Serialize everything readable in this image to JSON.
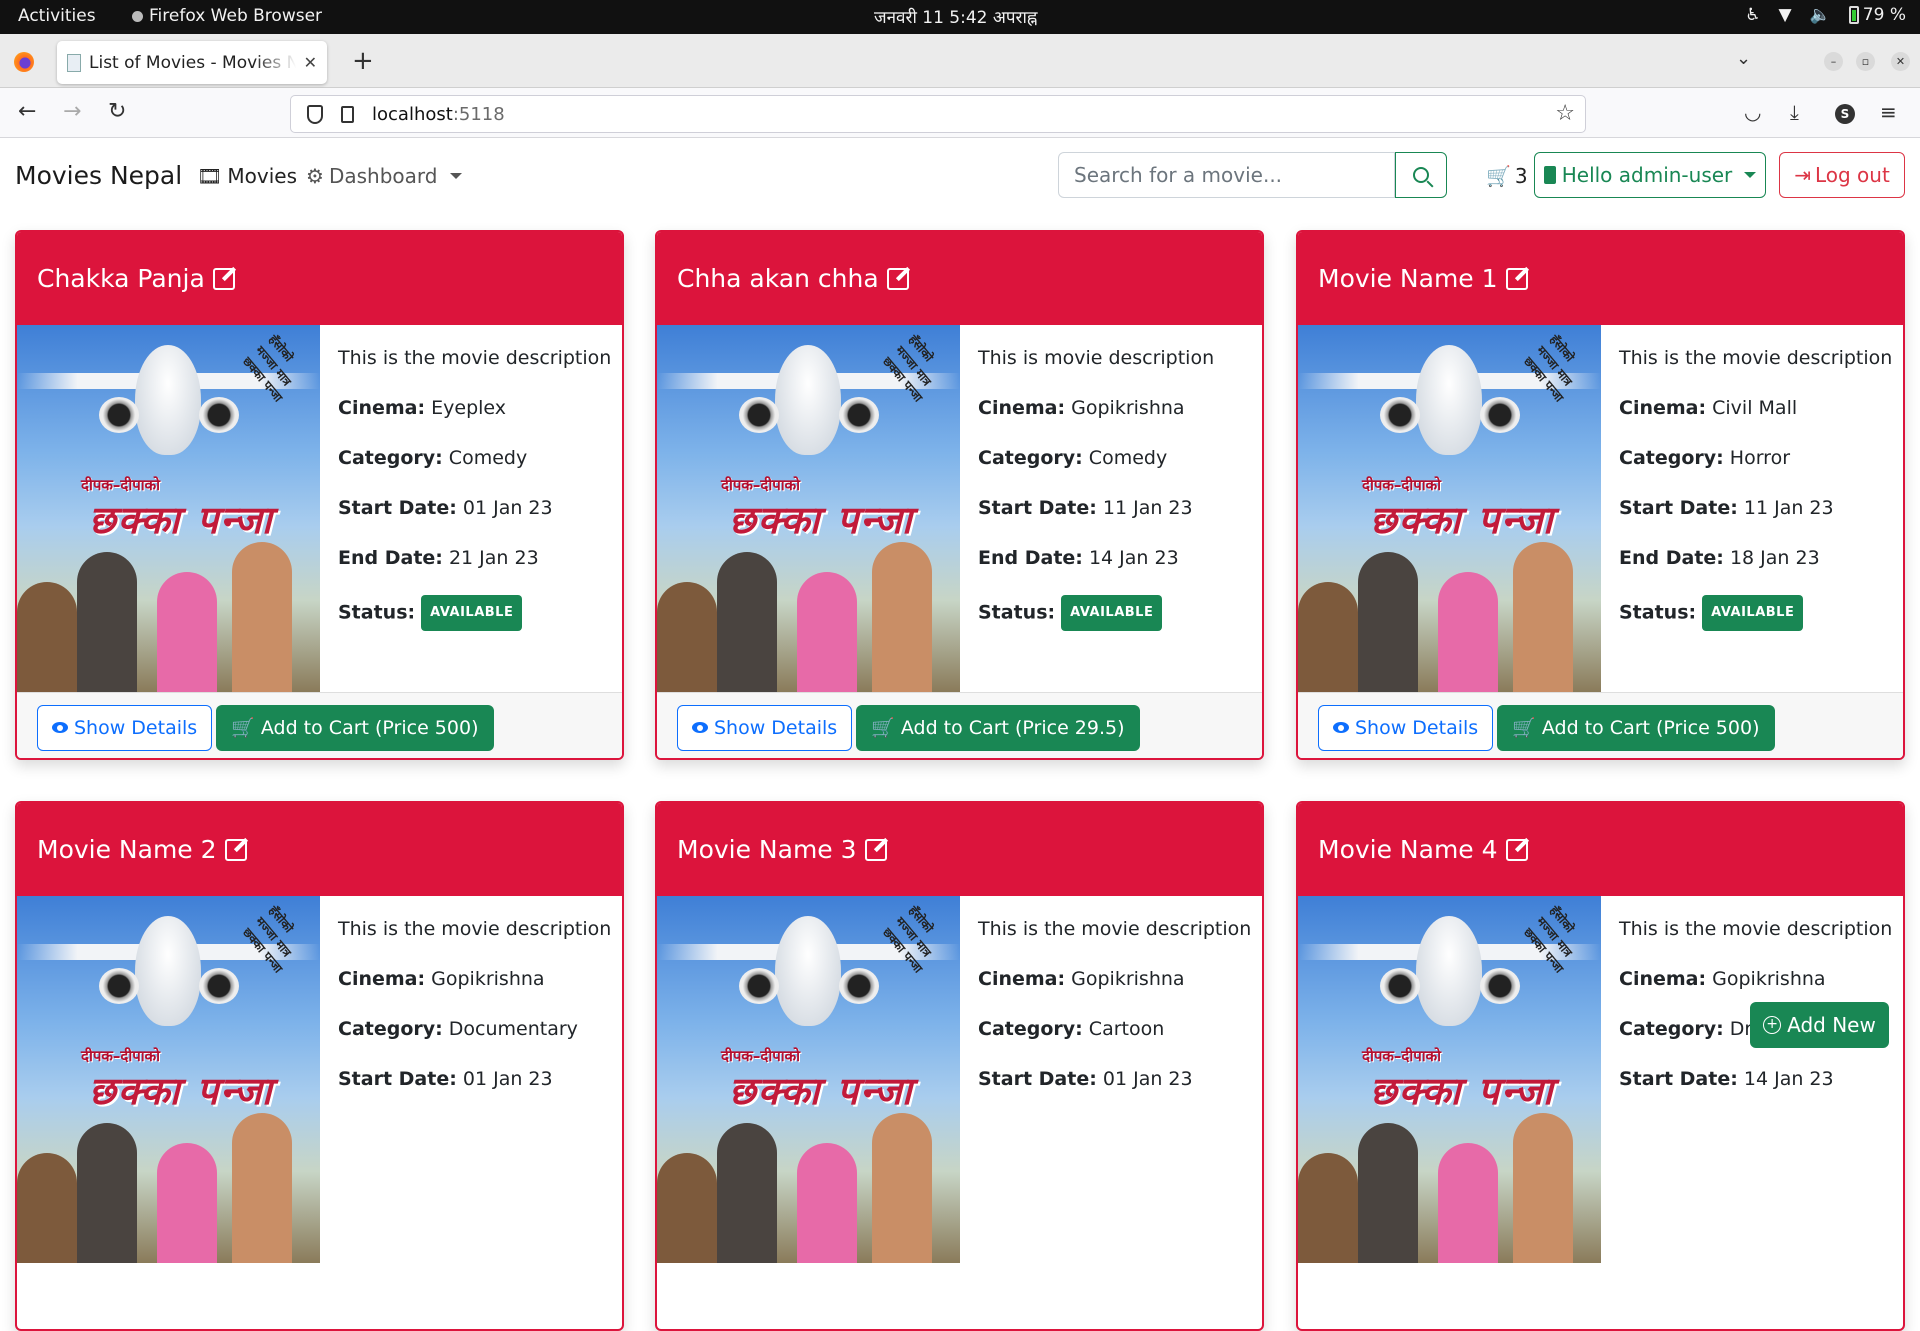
{
  "system": {
    "activities": "Activities",
    "app_name": "Firefox Web Browser",
    "clock": "जनवरी 11   5:42 अपराह्न",
    "battery": "79 %"
  },
  "browser": {
    "tab_title": "List of Movies - Movies Nepal",
    "url_host": "localhost",
    "url_port": ":5118",
    "profile_initial": "S"
  },
  "nav": {
    "brand": "Movies Nepal",
    "movies": "Movies",
    "dashboard": "Dashboard",
    "search_placeholder": "Search for a movie...",
    "cart_count": "3",
    "user_label": "Hello admin-user",
    "logout": "Log out"
  },
  "labels": {
    "cinema": "Cinema:",
    "category": "Category:",
    "start": "Start Date:",
    "end": "End Date:",
    "status": "Status:",
    "show_details": "Show Details",
    "add_new": "Add New"
  },
  "poster": {
    "line1": "दीपक–दीपाको",
    "line2": "छक्का पन्जा",
    "tagline": "हँसाेको मज्जा मात्र छक्का पन्जा"
  },
  "movies": [
    {
      "title": "Chakka Panja",
      "description": "This is the movie description",
      "cinema": "Eyeplex",
      "category": "Comedy",
      "start": "01 Jan 23",
      "end": "21 Jan 23",
      "status": "AVAILABLE",
      "cart_label": "Add to Cart (Price 500)"
    },
    {
      "title": "Chha akan chha",
      "description": "This is movie description",
      "cinema": "Gopikrishna",
      "category": "Comedy",
      "start": "11 Jan 23",
      "end": "14 Jan 23",
      "status": "AVAILABLE",
      "cart_label": "Add to Cart (Price 29.5)"
    },
    {
      "title": "Movie Name 1",
      "description": "This is the movie description",
      "cinema": "Civil Mall",
      "category": "Horror",
      "start": "11 Jan 23",
      "end": "18 Jan 23",
      "status": "AVAILABLE",
      "cart_label": "Add to Cart (Price 500)"
    },
    {
      "title": "Movie Name 2",
      "description": "This is the movie description",
      "cinema": "Gopikrishna",
      "category": "Documentary",
      "start": "01 Jan 23"
    },
    {
      "title": "Movie Name 3",
      "description": "This is the movie description",
      "cinema": "Gopikrishna",
      "category": "Cartoon",
      "start": "01 Jan 23"
    },
    {
      "title": "Movie Name 4",
      "description": "This is the movie description",
      "cinema": "Gopikrishna",
      "category": "Drama",
      "start": "14 Jan 23"
    }
  ],
  "colors": {
    "card_header": "#dc143c",
    "success": "#198754",
    "primary": "#0d6efd",
    "danger": "#dc3545"
  }
}
